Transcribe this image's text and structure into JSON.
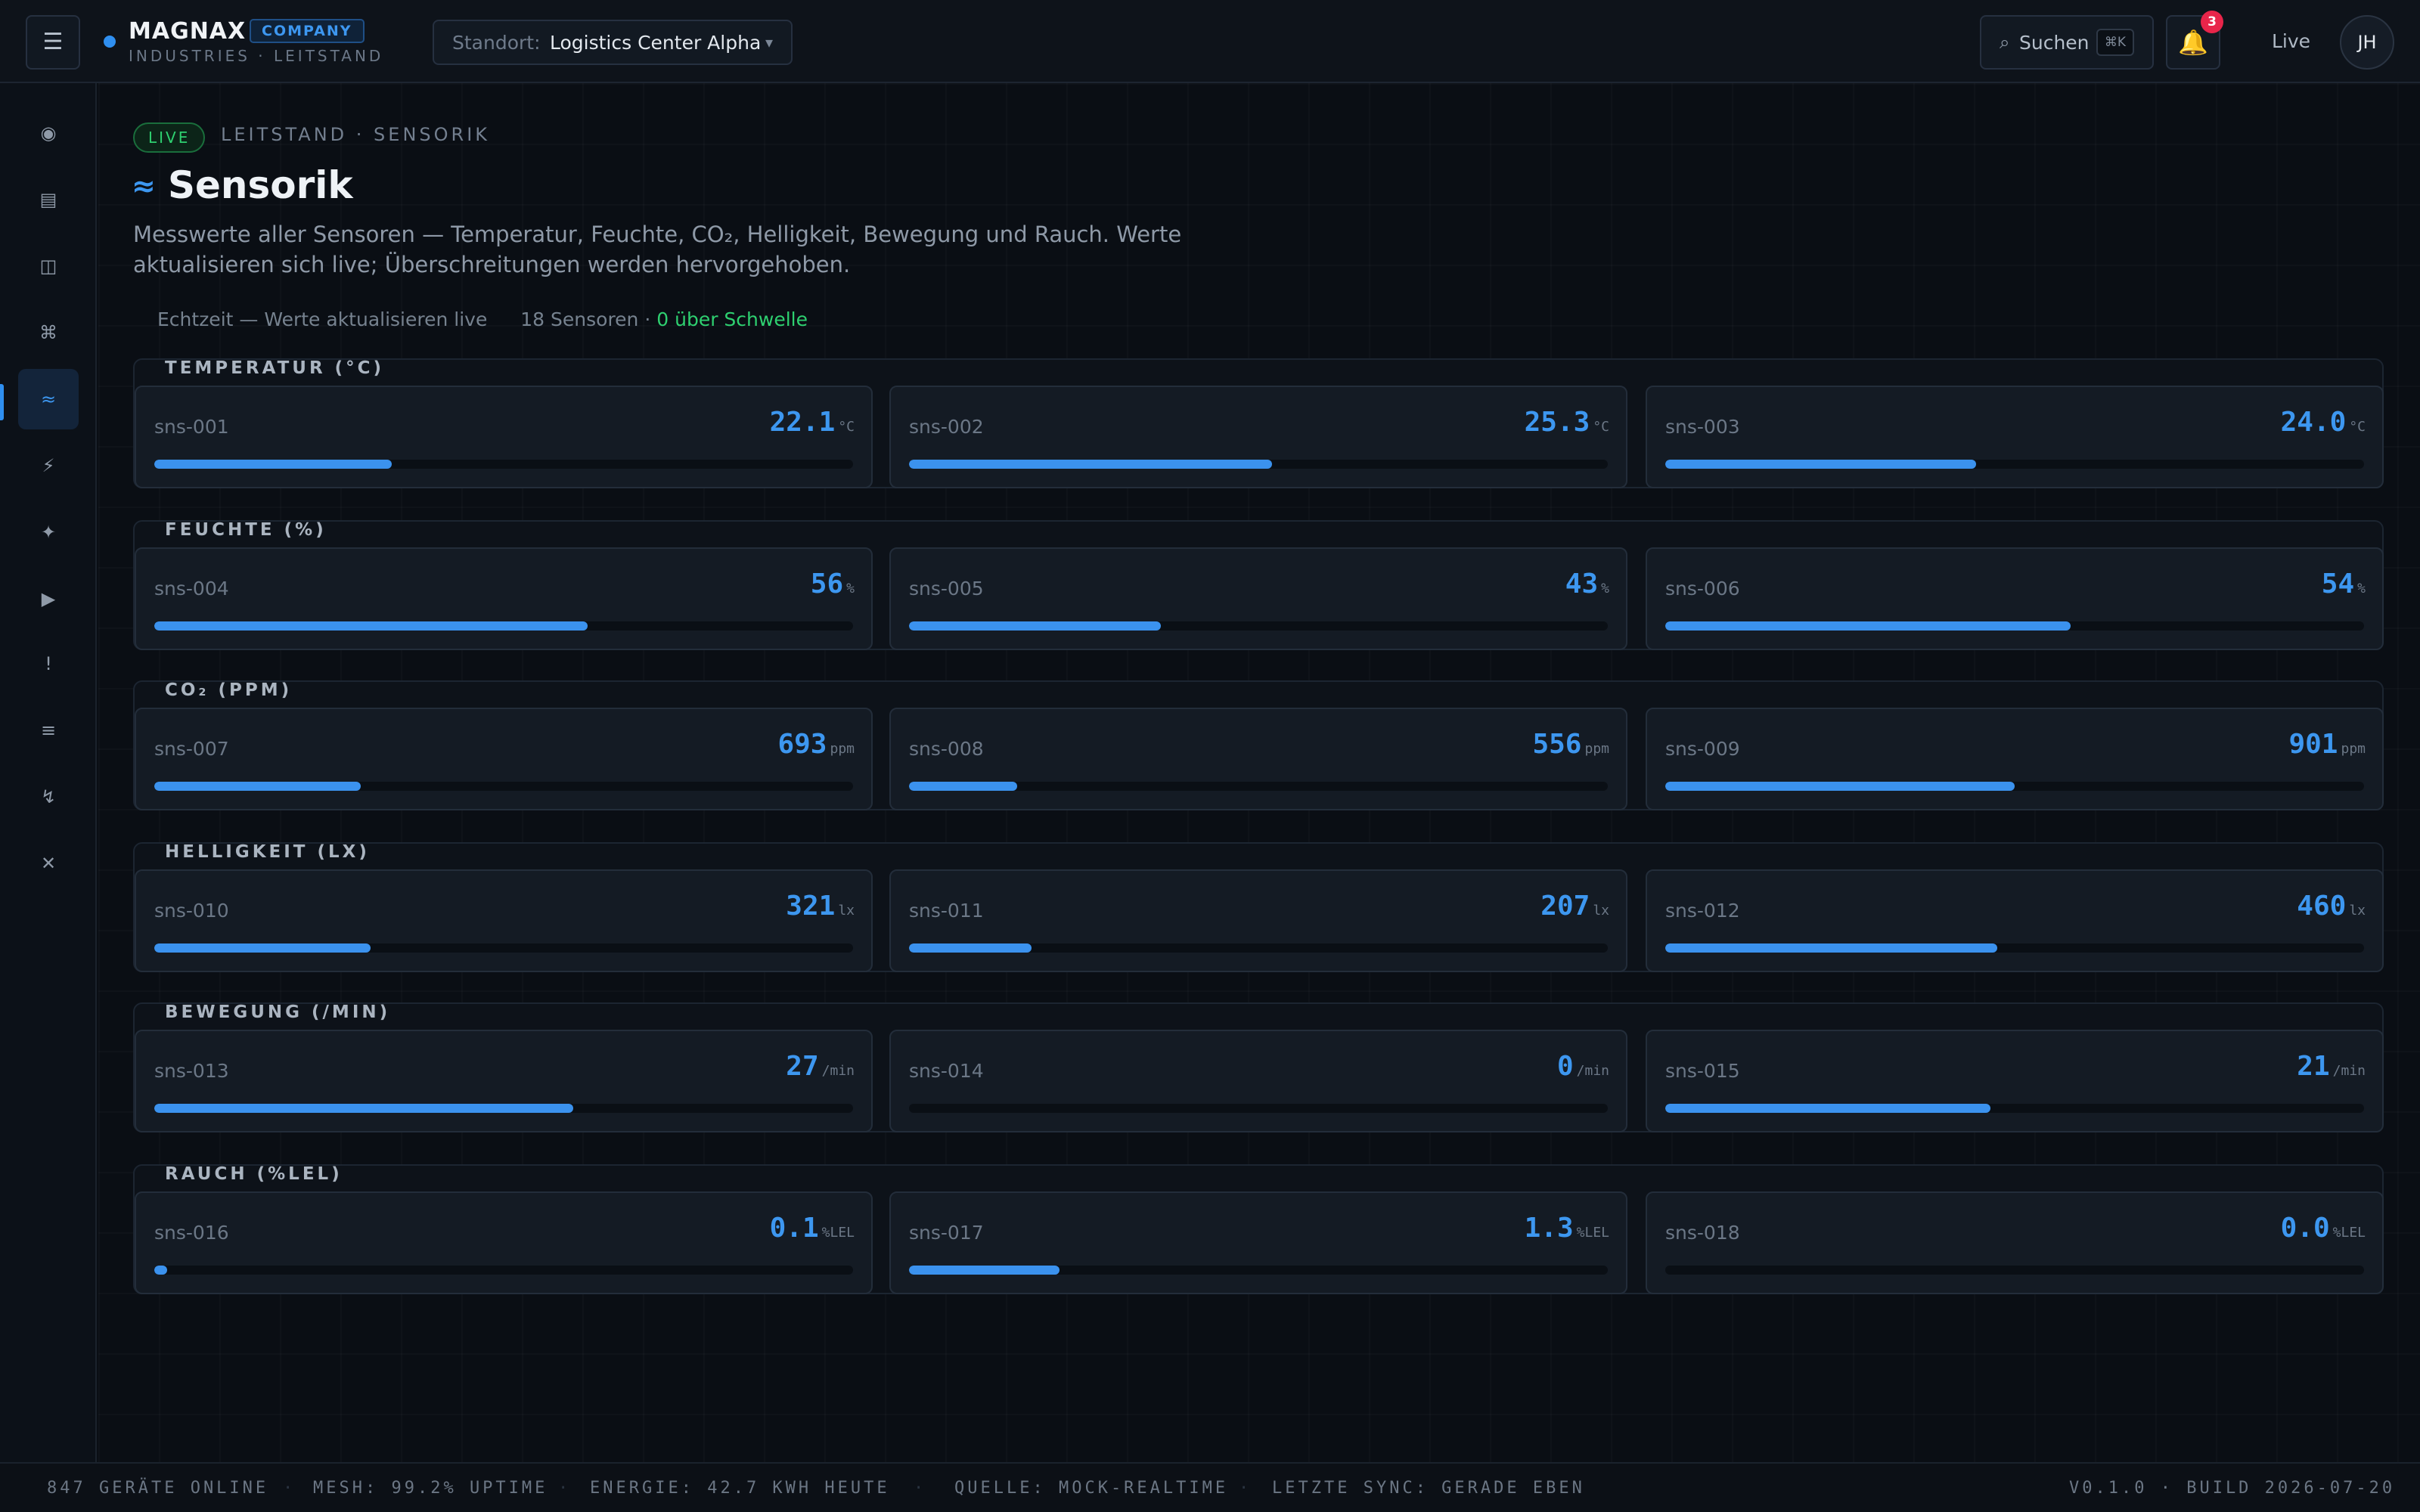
{
  "topbar": {
    "menu_icon": "☰",
    "brand": {
      "name": "MAGNAX",
      "badge": "COMPANY",
      "subtitle": "INDUSTRIES · LEITSTAND"
    },
    "site": {
      "label": "Standort:",
      "value": "Logistics Center Alpha",
      "caret": "▾"
    },
    "search": {
      "icon": "⌕",
      "label": "Suchen",
      "shortcut": "⌘K"
    },
    "notifications": {
      "icon": "🔔",
      "count": "3"
    },
    "live_label": "Live",
    "avatar_initials": "JH"
  },
  "sidebar": {
    "items": [
      {
        "name": "dashboard",
        "icon": "◉"
      },
      {
        "name": "reports",
        "icon": "▤"
      },
      {
        "name": "layout",
        "icon": "◫"
      },
      {
        "name": "network",
        "icon": "⌘"
      },
      {
        "name": "sensors",
        "icon": "≈",
        "active": true
      },
      {
        "name": "energy",
        "icon": "⚡"
      },
      {
        "name": "automation",
        "icon": "✦"
      },
      {
        "name": "playback",
        "icon": "▶"
      },
      {
        "name": "alerts",
        "icon": "!"
      },
      {
        "name": "list",
        "icon": "≡"
      },
      {
        "name": "power",
        "icon": "↯"
      },
      {
        "name": "close",
        "icon": "✕"
      }
    ]
  },
  "header": {
    "live_badge": "LIVE",
    "breadcrumb": "LEITSTAND · SENSORIK",
    "title_icon": "≈",
    "title": "Sensorik",
    "description": "Messwerte aller Sensoren — Temperatur, Feuchte, CO₂, Helligkeit, Bewegung und Rauch. Werte aktualisieren sich live; Überschreitungen werden hervorgehoben."
  },
  "status": {
    "realtime": "Echtzeit — Werte aktualisieren live",
    "count": "18 Sensoren ·",
    "threshold": "0 über Schwelle"
  },
  "sections": [
    {
      "title": "TEMPERATUR (°C)",
      "sensors": [
        {
          "id": "sns-001",
          "value": "22.1",
          "unit": "°C",
          "level": 0.34
        },
        {
          "id": "sns-002",
          "value": "25.3",
          "unit": "°C",
          "level": 0.52
        },
        {
          "id": "sns-003",
          "value": "24.0",
          "unit": "°C",
          "level": 0.445
        }
      ]
    },
    {
      "title": "FEUCHTE (%)",
      "sensors": [
        {
          "id": "sns-004",
          "value": "56",
          "unit": "%",
          "level": 0.62
        },
        {
          "id": "sns-005",
          "value": "43",
          "unit": "%",
          "level": 0.36
        },
        {
          "id": "sns-006",
          "value": "54",
          "unit": "%",
          "level": 0.58
        }
      ]
    },
    {
      "title": "CO₂ (PPM)",
      "sensors": [
        {
          "id": "sns-007",
          "value": "693",
          "unit": "ppm",
          "level": 0.295
        },
        {
          "id": "sns-008",
          "value": "556",
          "unit": "ppm",
          "level": 0.155
        },
        {
          "id": "sns-009",
          "value": "901",
          "unit": "ppm",
          "level": 0.5
        }
      ]
    },
    {
      "title": "HELLIGKEIT (LX)",
      "sensors": [
        {
          "id": "sns-010",
          "value": "321",
          "unit": "lx",
          "level": 0.31
        },
        {
          "id": "sns-011",
          "value": "207",
          "unit": "lx",
          "level": 0.175
        },
        {
          "id": "sns-012",
          "value": "460",
          "unit": "lx",
          "level": 0.475
        }
      ]
    },
    {
      "title": "BEWEGUNG (/MIN)",
      "sensors": [
        {
          "id": "sns-013",
          "value": "27",
          "unit": "/min",
          "level": 0.6
        },
        {
          "id": "sns-014",
          "value": "0",
          "unit": "/min",
          "level": 0
        },
        {
          "id": "sns-015",
          "value": "21",
          "unit": "/min",
          "level": 0.465
        }
      ]
    },
    {
      "title": "RAUCH (%LEL)",
      "sensors": [
        {
          "id": "sns-016",
          "value": "0.1",
          "unit": "%LEL",
          "level": 0.018
        },
        {
          "id": "sns-017",
          "value": "1.3",
          "unit": "%LEL",
          "level": 0.215
        },
        {
          "id": "sns-018",
          "value": "0.0",
          "unit": "%LEL",
          "level": 0
        }
      ]
    }
  ],
  "footer": {
    "devices": "847 GERÄTE ONLINE",
    "mesh": "MESH: 99.2% UPTIME",
    "energy": "ENERGIE: 42.7 KWH HEUTE",
    "source": "QUELLE: MOCK-REALTIME",
    "sync": "LETZTE SYNC: GERADE EBEN",
    "build": "V0.1.0 · BUILD 2026-07-20",
    "separator": "·"
  },
  "colors": {
    "accent": "#3d97f0",
    "live_green": "#2ed070",
    "alert_red": "#e8254a",
    "background": "#0a0e14"
  }
}
